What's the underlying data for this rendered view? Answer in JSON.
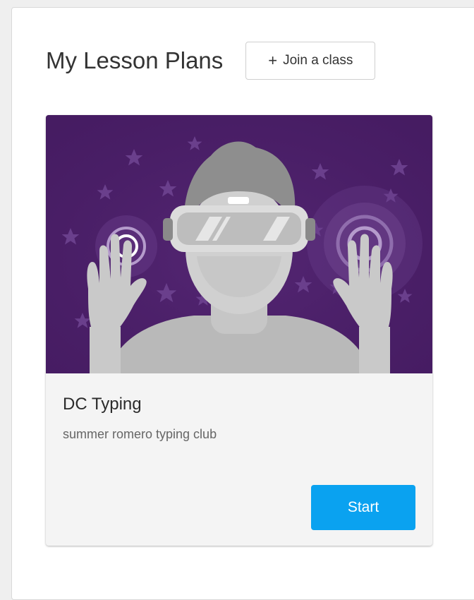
{
  "header": {
    "title": "My Lesson Plans",
    "join_plus": "+",
    "join_label": "Join a class"
  },
  "lesson_card": {
    "title": "DC Typing",
    "subtitle": "summer romero typing club",
    "start_label": "Start",
    "illustration": "vr-headset-person-illustration"
  },
  "colors": {
    "illustration_bg": "#4b1f69",
    "start_button": "#0aa2f0",
    "figure_gray": "#c9c9c9"
  }
}
